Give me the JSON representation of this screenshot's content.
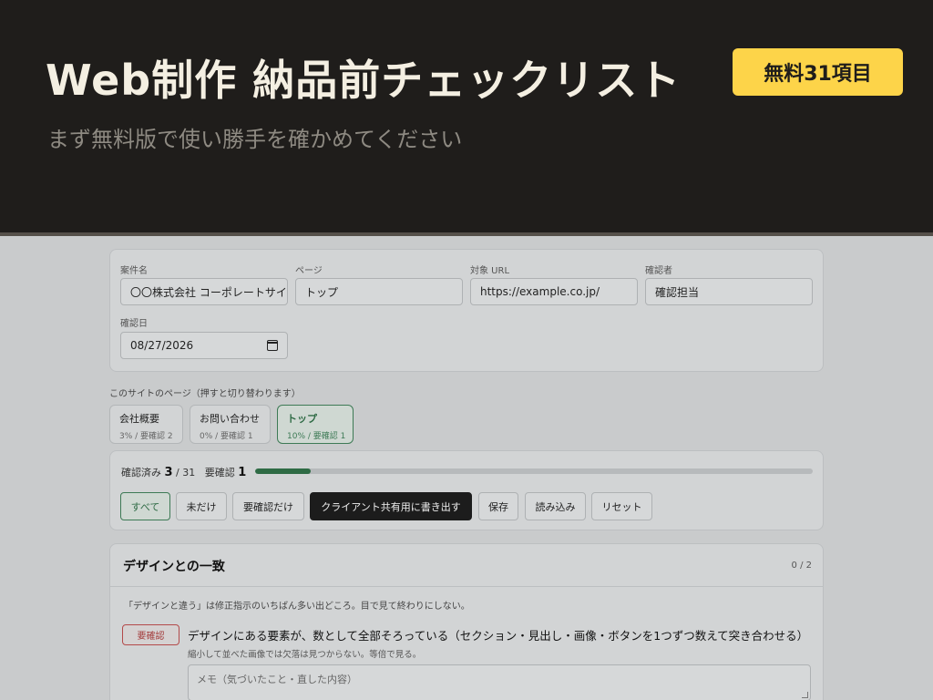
{
  "banner": {
    "title": "Web制作 納品前チェックリスト",
    "subtitle": "まず無料版で使い勝手を確かめてください",
    "badge": "無料31項目"
  },
  "form": {
    "project": {
      "label": "案件名",
      "value": "〇〇株式会社 コーポレートサイ"
    },
    "page": {
      "label": "ページ",
      "value": "トップ"
    },
    "url": {
      "label": "対象 URL",
      "value": "https://example.co.jp/"
    },
    "reviewer": {
      "label": "確認者",
      "value": "確認担当"
    },
    "date": {
      "label": "確認日",
      "value": "08/27/2026"
    }
  },
  "pages_section": {
    "label": "このサイトのページ（押すと切り替わります）",
    "tabs": [
      {
        "name": "会社概要",
        "stat": "3% / 要確認 2"
      },
      {
        "name": "お問い合わせ",
        "stat": "0% / 要確認 1"
      },
      {
        "name": "トップ",
        "stat": "10% / 要確認 1"
      }
    ]
  },
  "progress": {
    "checked_label": "確認済み",
    "checked": "3",
    "total": "/ 31",
    "needs_label": "要確認",
    "needs": "1",
    "fraction": 0.1
  },
  "filters": {
    "all": "すべて",
    "unchecked": "未だけ",
    "needs_only": "要確認だけ",
    "export": "クライアント共有用に書き出す",
    "save": "保存",
    "load": "読み込み",
    "reset": "リセット"
  },
  "category": {
    "title": "デザインとの一致",
    "count": "0 / 2",
    "description": "「デザインと違う」は修正指示のいちばん多い出どころ。目で見て終わりにしない。",
    "item": {
      "status": "要確認",
      "text": "デザインにある要素が、数として全部そろっている（セクション・見出し・画像・ボタンを1つずつ数えて突き合わせる）",
      "note": "縮小して並べた画像では欠落は見つからない。等倍で見る。",
      "memo_placeholder": "メモ（気づいたこと・直した内容）"
    }
  },
  "colors": {
    "banner_bg": "#1f1d1b",
    "badge_bg": "#fdd449",
    "accent_green": "#2f6b45",
    "warning_red": "#b34a4a"
  }
}
